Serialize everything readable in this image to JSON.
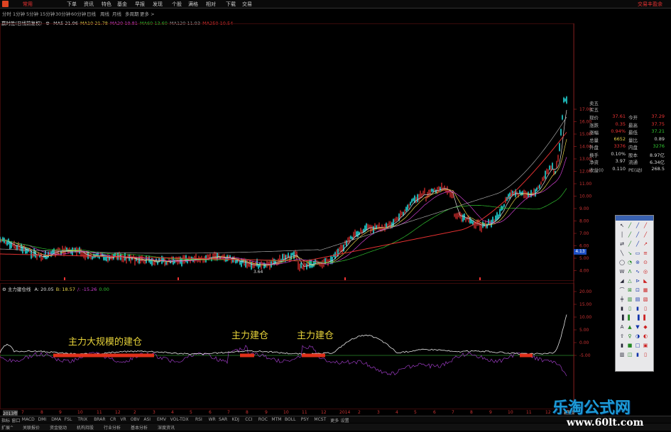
{
  "menu": {
    "items": [
      "常用",
      "下单",
      "资讯",
      "特色",
      "基金",
      "早报",
      "发现",
      "个股",
      "满格",
      "相对",
      "下载",
      "交易"
    ],
    "active_index": 0,
    "trade_link": "交易丰盈余"
  },
  "periods": [
    "分时",
    "1分钟",
    "5分钟",
    "15分钟",
    "30分钟",
    "60分钟",
    "日线",
    "周线",
    "月线",
    "多周期",
    "更多 >"
  ],
  "ma_line": {
    "title": "赢时胜(日线前复权)",
    "items": [
      {
        "label": "MA5 21.96",
        "color": "#dddddd"
      },
      {
        "label": "MA10 21.78",
        "color": "#e6d24a"
      },
      {
        "label": "MA20 19.81",
        "color": "#d040d0"
      },
      {
        "label": "MA60 13.60",
        "color": "#30c030"
      },
      {
        "label": "MA120 11.93",
        "color": "#9a9a9a"
      },
      {
        "label": "MA250 10.54",
        "color": "#e03030"
      }
    ]
  },
  "price_axis": [
    "17.00",
    "16.00",
    "15.00",
    "14.00",
    "13.00",
    "12.00",
    "11.00",
    "10.00",
    "9.00",
    "8.00",
    "7.00",
    "6.00",
    "5.00",
    "4.00"
  ],
  "current_price_tag": "4.13",
  "low_label": "3.64",
  "right_panel": {
    "header1": "卖五",
    "header2": "买五",
    "rows": [
      {
        "l1": "现价",
        "v1": "37.61",
        "l2": "今开",
        "v2": "37.29"
      },
      {
        "l1": "涨跌",
        "v1": "0.35",
        "l2": "最高",
        "v2": "37.75"
      },
      {
        "l1": "涨幅",
        "v1": "0.94%",
        "l2": "最低",
        "v2": "37.21"
      },
      {
        "l1": "总量",
        "v1": "6652",
        "l2": "量比",
        "v2": "0.89"
      },
      {
        "l1": "外盘",
        "v1": "3376",
        "l2": "内盘",
        "v2": "3276"
      },
      {
        "l1": "换手",
        "v1": "0.10%",
        "l2": "股本",
        "v2": "8.97亿"
      },
      {
        "l1": "净资",
        "v1": "3.97",
        "l2": "流通",
        "v2": "6.34亿"
      },
      {
        "l1": "收益(I)",
        "v1": "0.110",
        "l2": "PE(动)",
        "v2": "268.5"
      }
    ]
  },
  "sub_indicator": {
    "title": "主力建仓线",
    "values": [
      {
        "label": "A: 20.05",
        "color": "#dddddd"
      },
      {
        "label": "B: 18.57",
        "color": "#e6d24a"
      },
      {
        "label": "/: -15.26",
        "color": "#d040d0"
      },
      {
        "label": "0.00",
        "color": "#30c030"
      }
    ],
    "axis": [
      "20.00",
      "15.00",
      "10.00",
      "5.00",
      "0.00",
      "-5.00"
    ]
  },
  "annotations": [
    "主力大规模的建仓",
    "主力建仓",
    "主力建仓"
  ],
  "time_axis": [
    "2013年",
    "7",
    "8",
    "9",
    "10",
    "11",
    "12",
    "2",
    "3",
    "4",
    "5",
    "6",
    "7",
    "8",
    "9",
    "10",
    "11",
    "12",
    "2014",
    "2",
    "3",
    "4",
    "5",
    "6",
    "7",
    "8",
    "9",
    "10",
    "11",
    "12",
    "2015"
  ],
  "bottom_tabs": [
    "指标",
    "窗口",
    "MACD",
    "DMI",
    "DMA",
    "FSL",
    "TRIX",
    "BRAR",
    "CR",
    "VR",
    "OBV",
    "ASI",
    "EMV",
    "VOL-TDX",
    "RSI",
    "WR",
    "SAR",
    "KDJ",
    "CCI",
    "ROC",
    "MTM",
    "BOLL",
    "PSY",
    "MCST",
    "更多",
    "设置"
  ],
  "bottom_tabs2": [
    "扩展^",
    "关联报价",
    "资金驱动",
    "机构持股",
    "行业分析",
    "基本分析",
    "深度资讯"
  ],
  "watermark": {
    "title": "乐淘公式网",
    "url": "www.60lt.com"
  }
}
